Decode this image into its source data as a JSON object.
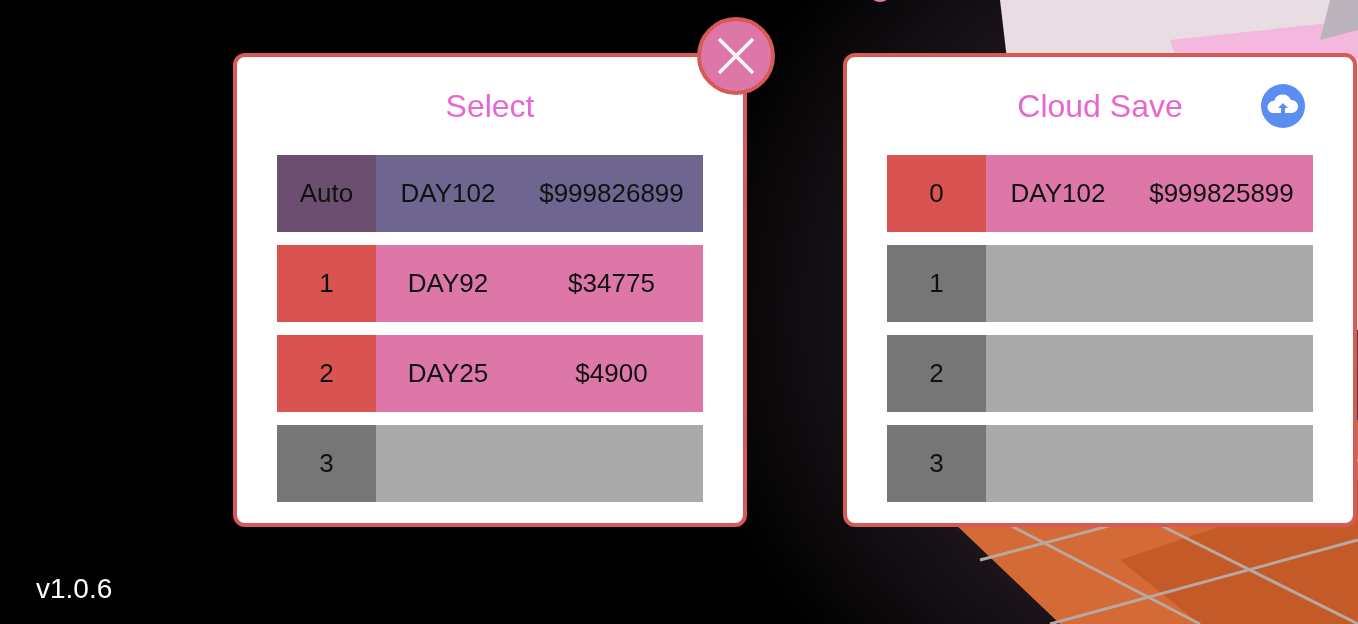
{
  "panels": [
    {
      "title": "Select",
      "close_button": true,
      "cloud_button": false,
      "slots": [
        {
          "kind": "auto",
          "label": "Auto",
          "day": "DAY102",
          "money": "$999826899"
        },
        {
          "kind": "filled",
          "label": "1",
          "day": "DAY92",
          "money": "$34775"
        },
        {
          "kind": "filled",
          "label": "2",
          "day": "DAY25",
          "money": "$4900"
        },
        {
          "kind": "empty",
          "label": "3"
        }
      ]
    },
    {
      "title": "Cloud Save",
      "close_button": false,
      "cloud_button": true,
      "slots": [
        {
          "kind": "filled",
          "label": "0",
          "day": "DAY102",
          "money": "$999825899"
        },
        {
          "kind": "empty",
          "label": "1"
        },
        {
          "kind": "empty",
          "label": "2"
        },
        {
          "kind": "empty",
          "label": "3"
        }
      ]
    }
  ],
  "version": "v1.0.6"
}
